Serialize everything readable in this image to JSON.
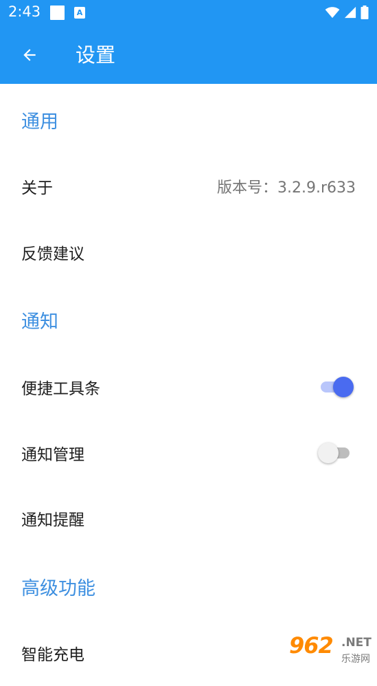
{
  "status_bar": {
    "time": "2:43",
    "notif_a_icon": "A"
  },
  "app_bar": {
    "title": "设置",
    "back_icon": "arrow-left"
  },
  "sections": {
    "general": {
      "title": "通用",
      "about": {
        "label": "关于",
        "value": "版本号：3.2.9.r633"
      },
      "feedback": {
        "label": "反馈建议"
      }
    },
    "notification": {
      "title": "通知",
      "quick_toolbar": {
        "label": "便捷工具条",
        "enabled": true
      },
      "notif_management": {
        "label": "通知管理",
        "enabled": false
      },
      "notif_reminder": {
        "label": "通知提醒"
      }
    },
    "advanced": {
      "title": "高级功能",
      "smart_charge": {
        "label": "智能充电"
      }
    }
  },
  "watermark": {
    "big": "962",
    "net": ".NET",
    "small": "乐游网"
  },
  "colors": {
    "primary": "#2196f3",
    "section": "#3d8fe0",
    "switch_on": "#4a6bf0"
  }
}
